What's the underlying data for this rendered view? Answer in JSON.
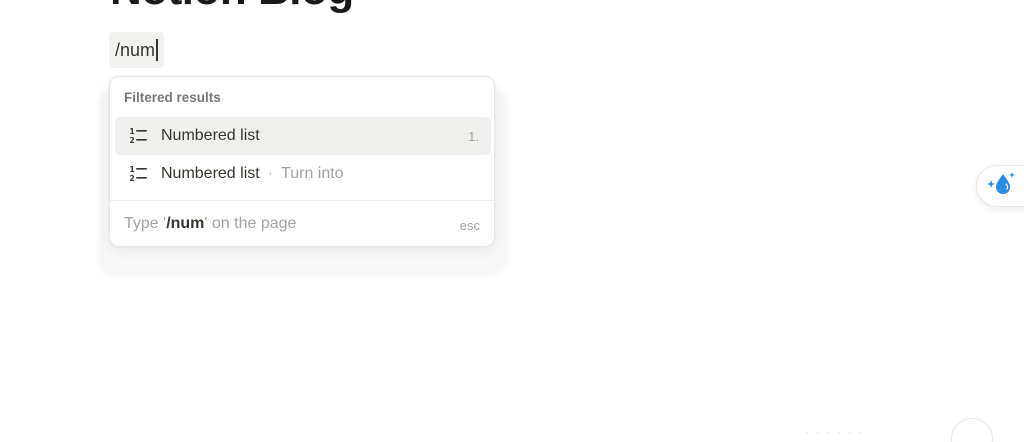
{
  "page": {
    "title": "Notion Blog"
  },
  "editor": {
    "slash_input": "/num"
  },
  "popup": {
    "header": "Filtered results",
    "items": [
      {
        "label": "Numbered list",
        "shortcut": "1.",
        "icon": "numbered-list-icon",
        "selected": true
      },
      {
        "label": "Numbered list",
        "separator": "·",
        "sublabel": "Turn into",
        "icon": "numbered-list-icon",
        "selected": false
      }
    ],
    "footer": {
      "prefix": "Type '",
      "query": "/num",
      "suffix": "' on the page",
      "esc": "esc"
    }
  },
  "floating": {
    "ai_icon": "ai-sparkle-drop-icon"
  },
  "colors": {
    "text": "#37352f",
    "muted": "#a3a29e",
    "selected_bg": "#efefed",
    "input_bg": "#f1f1ef",
    "accent_blue": "#2a8be0"
  }
}
